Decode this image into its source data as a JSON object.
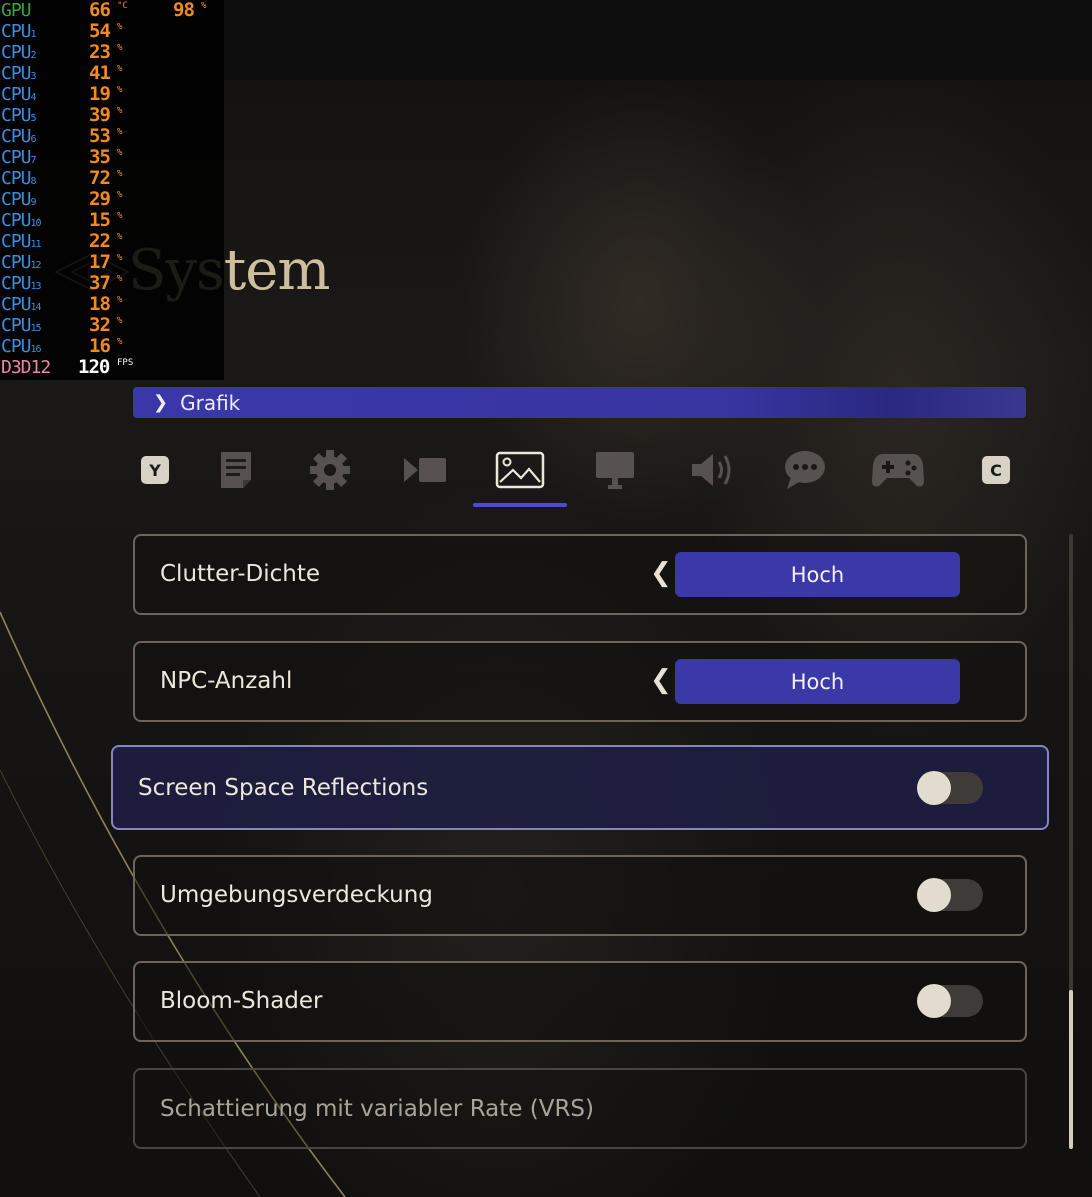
{
  "osd": {
    "gpu": {
      "label": "GPU",
      "temp": "66",
      "temp_unit": "°C",
      "load": "98",
      "load_unit": "%"
    },
    "cpus": [
      {
        "label": "CPU",
        "sub": "1",
        "value": "54",
        "unit": "%"
      },
      {
        "label": "CPU",
        "sub": "2",
        "value": "23",
        "unit": "%"
      },
      {
        "label": "CPU",
        "sub": "3",
        "value": "41",
        "unit": "%"
      },
      {
        "label": "CPU",
        "sub": "4",
        "value": "19",
        "unit": "%"
      },
      {
        "label": "CPU",
        "sub": "5",
        "value": "39",
        "unit": "%"
      },
      {
        "label": "CPU",
        "sub": "6",
        "value": "53",
        "unit": "%"
      },
      {
        "label": "CPU",
        "sub": "7",
        "value": "35",
        "unit": "%"
      },
      {
        "label": "CPU",
        "sub": "8",
        "value": "72",
        "unit": "%"
      },
      {
        "label": "CPU",
        "sub": "9",
        "value": "29",
        "unit": "%"
      },
      {
        "label": "CPU",
        "sub": "10",
        "value": "15",
        "unit": "%"
      },
      {
        "label": "CPU",
        "sub": "11",
        "value": "22",
        "unit": "%"
      },
      {
        "label": "CPU",
        "sub": "12",
        "value": "17",
        "unit": "%"
      },
      {
        "label": "CPU",
        "sub": "13",
        "value": "37",
        "unit": "%"
      },
      {
        "label": "CPU",
        "sub": "14",
        "value": "18",
        "unit": "%"
      },
      {
        "label": "CPU",
        "sub": "15",
        "value": "32",
        "unit": "%"
      },
      {
        "label": "CPU",
        "sub": "16",
        "value": "16",
        "unit": "%"
      }
    ],
    "api": {
      "label": "D3D12",
      "fps": "120",
      "fps_unit": "FPS"
    }
  },
  "header": {
    "title": "System"
  },
  "breadcrumb": {
    "chevron": "❯",
    "label": "Grafik"
  },
  "tabs": {
    "left_key": "Y",
    "right_key": "C",
    "items": [
      {
        "icon": "document-icon"
      },
      {
        "icon": "gear-icon"
      },
      {
        "icon": "camera-icon"
      },
      {
        "icon": "image-icon",
        "active": true
      },
      {
        "icon": "monitor-icon"
      },
      {
        "icon": "speaker-icon"
      },
      {
        "icon": "chat-icon"
      },
      {
        "icon": "gamepad-icon"
      }
    ]
  },
  "settings": [
    {
      "label": "Clutter-Dichte",
      "type": "select",
      "value": "Hoch",
      "arrow": "❮"
    },
    {
      "label": "NPC-Anzahl",
      "type": "select",
      "value": "Hoch",
      "arrow": "❮"
    },
    {
      "label": "Screen Space Reflections",
      "type": "toggle",
      "on": false,
      "selected": true
    },
    {
      "label": "Umgebungsverdeckung",
      "type": "toggle",
      "on": false
    },
    {
      "label": "Bloom-Shader",
      "type": "toggle",
      "on": false
    },
    {
      "label": "Schattierung mit variabler Rate (VRS)",
      "type": "disabled"
    }
  ],
  "colors": {
    "accent": "#3b38a8",
    "osd_value": "#f28a1c",
    "osd_gpu": "#3aa53a",
    "osd_cpu": "#3a8fe0"
  }
}
